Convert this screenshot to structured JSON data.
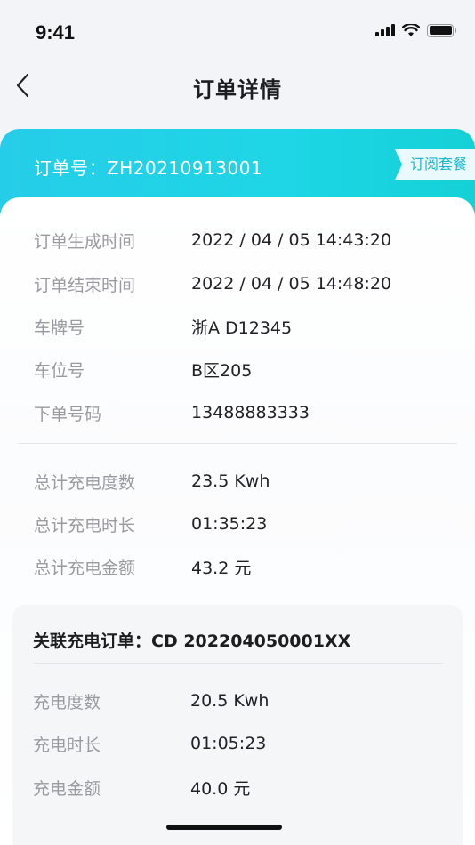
{
  "status_bar": {
    "time": "9:41"
  },
  "nav": {
    "title": "订单详情"
  },
  "order": {
    "number_text": "订单号：ZH20210913001",
    "subscription_tag": "订阅套餐"
  },
  "details": [
    {
      "label": "订单生成时间",
      "value": "2022 / 04 / 05  14:43:20"
    },
    {
      "label": "订单结束时间",
      "value": "2022 / 04 / 05  14:48:20"
    },
    {
      "label": "车牌号",
      "value": "浙A D12345"
    },
    {
      "label": "车位号",
      "value": "B区205"
    },
    {
      "label": "下单号码",
      "value": "13488883333"
    }
  ],
  "totals": [
    {
      "label": "总计充电度数",
      "value": "23.5 Kwh"
    },
    {
      "label": "总计充电时长",
      "value": "01:35:23"
    },
    {
      "label": "总计充电金额",
      "value": "43.2 元"
    }
  ],
  "related": {
    "title": "关联充电订单：CD 202204050001XX",
    "rows": [
      {
        "label": "充电度数",
        "value": "20.5 Kwh"
      },
      {
        "label": "充电时长",
        "value": "01:05:23"
      },
      {
        "label": "充电金额",
        "value": "40.0 元"
      }
    ]
  },
  "colors": {
    "accent": "#1ed6e6",
    "label_gray": "#9a9aa0",
    "text_dark": "#222226"
  }
}
